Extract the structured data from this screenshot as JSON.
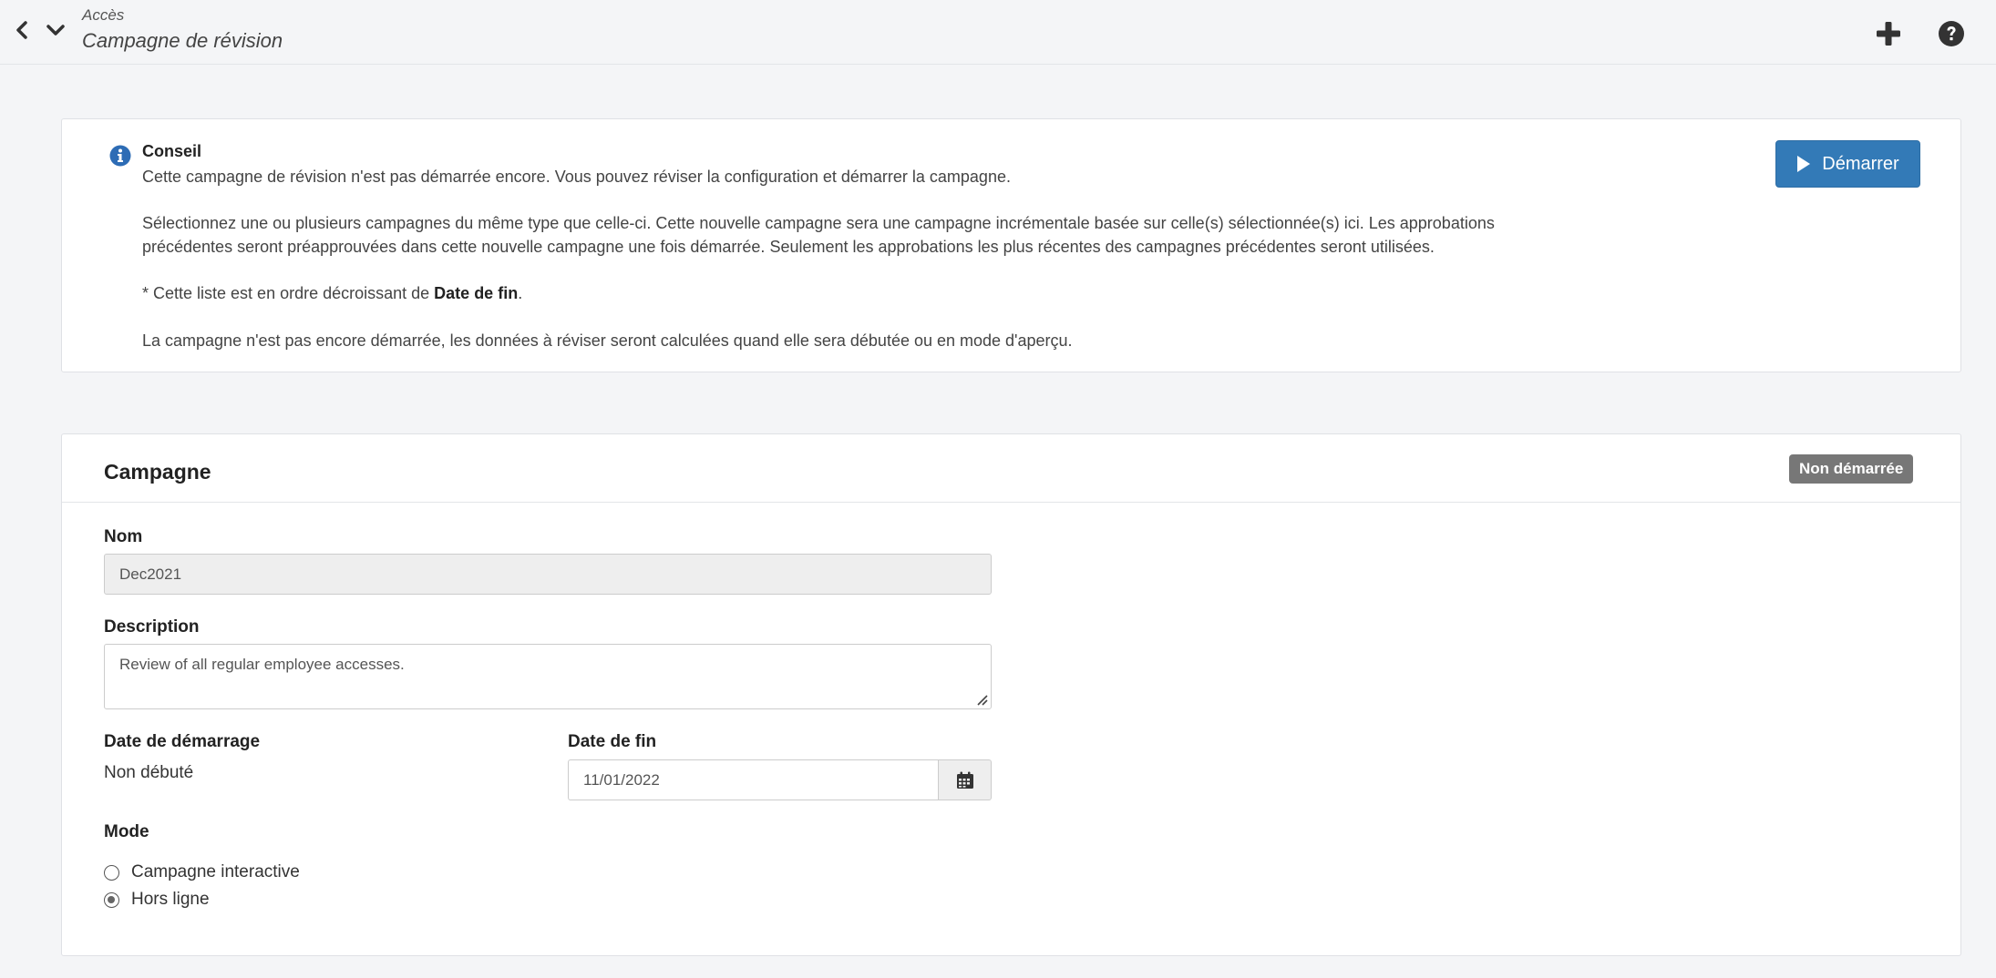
{
  "header": {
    "breadcrumb": "Accès",
    "title": "Campagne de révision",
    "back_icon": "chevron-left-icon",
    "menu_icon": "chevron-down-icon",
    "add_icon": "plus-icon",
    "help_icon": "question-circle-icon"
  },
  "tip": {
    "title": "Conseil",
    "line1": "Cette campagne de révision n'est pas démarrée encore. Vous pouvez réviser la configuration et démarrer la campagne.",
    "line2": "Sélectionnez une ou plusieurs campagnes du même type que celle-ci. Cette nouvelle campagne sera une campagne incrémentale basée sur celle(s) sélectionnée(s) ici. Les approbations précédentes seront préapprouvées dans cette nouvelle campagne une fois démarrée. Seulement les approbations les plus récentes des campagnes précédentes seront utilisées.",
    "line3_prefix": "* Cette liste est en ordre décroissant de ",
    "line3_bold": "Date de fin",
    "line3_suffix": ".",
    "line4": "La campagne n'est pas encore démarrée, les données à réviser seront calculées quand elle sera débutée ou en mode d'aperçu.",
    "start_button": "Démarrer"
  },
  "campaign": {
    "title": "Campagne",
    "status": "Non démarrée",
    "name_label": "Nom",
    "name_value": "Dec2021",
    "description_label": "Description",
    "description_value": "Review of all regular employee accesses.",
    "start_date_label": "Date de démarrage",
    "start_date_value": "Non débuté",
    "end_date_label": "Date de fin",
    "end_date_value": "11/01/2022",
    "mode_label": "Mode",
    "modes": [
      {
        "label": "Campagne interactive",
        "checked": false
      },
      {
        "label": "Hors ligne",
        "checked": true
      }
    ]
  },
  "colors": {
    "primary": "#337ab7",
    "badge": "#777777",
    "info_icon": "#2d6cb5"
  }
}
